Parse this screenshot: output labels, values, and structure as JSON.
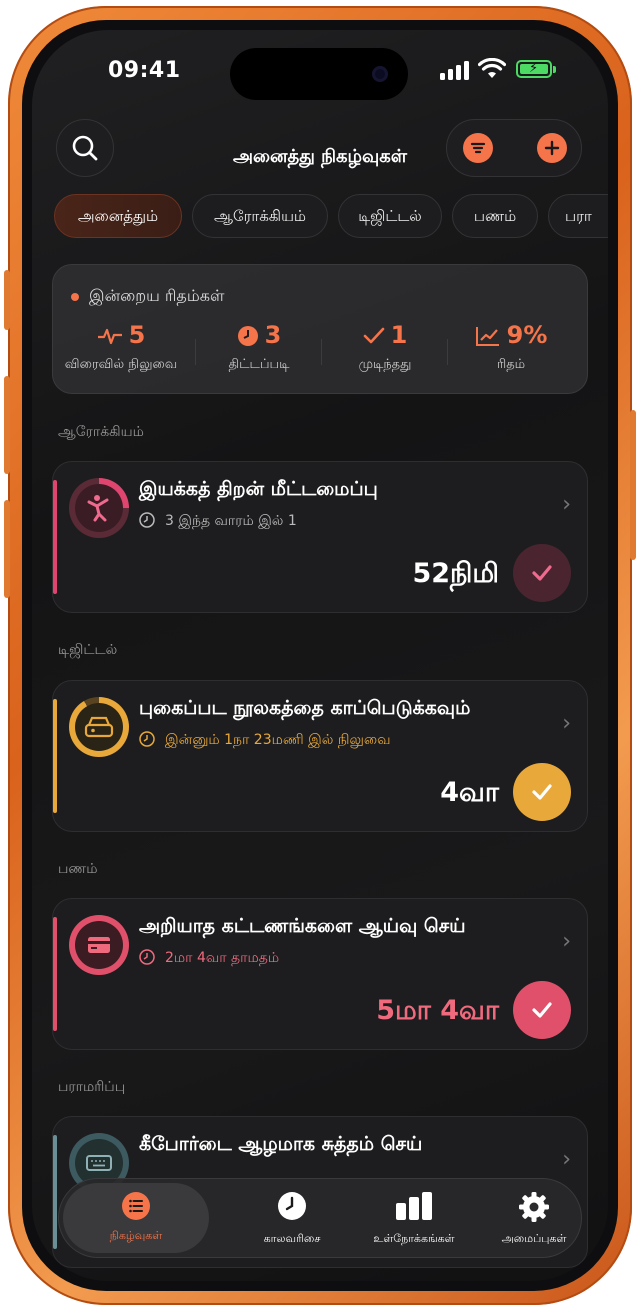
{
  "status_bar": {
    "time": "09:41"
  },
  "header": {
    "title": "அனைத்து நிகழ்வுகள்"
  },
  "chips": [
    "அனைத்தும்",
    "ஆரோக்கியம்",
    "டிஜிட்டல்",
    "பணம்",
    "பரா"
  ],
  "summary": {
    "title": "இன்றைய ரிதம்கள்",
    "stats": [
      {
        "value": "5",
        "label": "விரைவில் நிலுவை",
        "icon": "pulse-icon"
      },
      {
        "value": "3",
        "label": "திட்டப்படி",
        "icon": "clock-icon"
      },
      {
        "value": "1",
        "label": "முடிந்தது",
        "icon": "check-icon"
      },
      {
        "value": "9%",
        "label": "ரிதம்",
        "icon": "trend-up-icon"
      }
    ]
  },
  "sections": [
    {
      "label": "ஆரோக்கியம்",
      "card": {
        "title": "இயக்கத் திறன் மீட்டமைப்பு",
        "subtitle": "3 இந்த வாரம் இல் 1",
        "amount": "52நிமி",
        "accent": "#e0456f",
        "icon": "stretch-icon"
      }
    },
    {
      "label": "டிஜிட்டல்",
      "card": {
        "title": "புகைப்பட நூலகத்தை காப்பெடுக்கவும்",
        "subtitle": "இன்னும் 1நா 23மணி இல் நிலுவை",
        "amount": "4வா",
        "accent": "#e8a83a",
        "icon": "drive-icon"
      }
    },
    {
      "label": "பணம்",
      "card": {
        "title": "அறியாத கட்டணங்களை ஆய்வு செய்",
        "subtitle": "2மா 4வா தாமதம்",
        "amount": "5மா 4வா",
        "accent": "#e0506a",
        "icon": "credit-card-icon"
      }
    },
    {
      "label": "பராமரிப்பு",
      "card": {
        "title": "கீபோர்டை ஆழமாக சுத்தம் செய்",
        "accent": "#6a8f96",
        "icon": "keyboard-icon"
      }
    }
  ],
  "tabs": [
    {
      "label": "நிகழ்வுகள்",
      "icon": "list-icon",
      "active": true
    },
    {
      "label": "காலவரிசை",
      "icon": "clock-icon"
    },
    {
      "label": "உள்நோக்கங்கள்",
      "icon": "bar-chart-icon"
    },
    {
      "label": "அமைப்புகள்",
      "icon": "gear-icon"
    }
  ]
}
